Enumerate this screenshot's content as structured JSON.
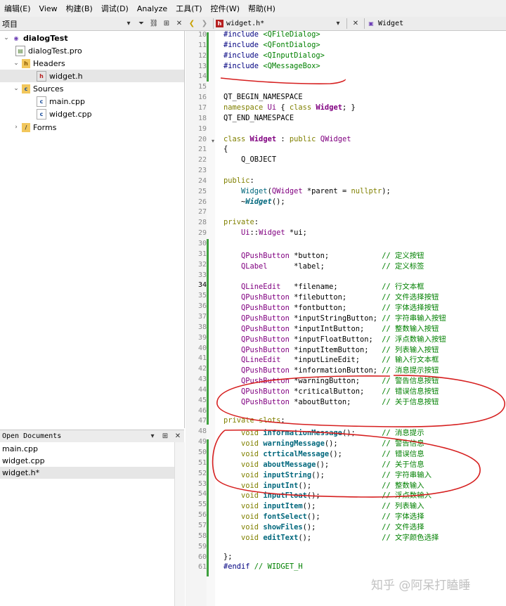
{
  "menu": [
    "编辑(E)",
    "View",
    "构建(B)",
    "调试(D)",
    "Analyze",
    "工具(T)",
    "控件(W)",
    "帮助(H)"
  ],
  "project_panel": {
    "title": "项目"
  },
  "tree": [
    {
      "label": "dialogTest",
      "bold": true
    },
    {
      "label": "dialogTest.pro"
    },
    {
      "label": "Headers"
    },
    {
      "label": "widget.h"
    },
    {
      "label": "Sources"
    },
    {
      "label": "main.cpp"
    },
    {
      "label": "widget.cpp"
    },
    {
      "label": "Forms"
    }
  ],
  "open_documents": {
    "title": "Open Documents",
    "items": [
      "main.cpp",
      "widget.cpp",
      "widget.h*"
    ]
  },
  "editor": {
    "file_tab": "widget.h*",
    "symbol": "Widget"
  },
  "code_lines": [
    {
      "n": "10",
      "c": "#include <QFileDialog>"
    },
    {
      "n": "11",
      "c": "#include <QFontDialog>"
    },
    {
      "n": "12",
      "c": "#include <QInputDialog>"
    },
    {
      "n": "13",
      "c": "#include <QMessageBox>"
    },
    {
      "n": "14",
      "c": ""
    },
    {
      "n": "15",
      "c": ""
    },
    {
      "n": "16",
      "c": "QT_BEGIN_NAMESPACE"
    },
    {
      "n": "17",
      "c": "namespace Ui { class Widget; }"
    },
    {
      "n": "18",
      "c": "QT_END_NAMESPACE"
    },
    {
      "n": "19",
      "c": ""
    },
    {
      "n": "20",
      "c": "class Widget : public QWidget"
    },
    {
      "n": "21",
      "c": "{"
    },
    {
      "n": "22",
      "c": "    Q_OBJECT"
    },
    {
      "n": "23",
      "c": ""
    },
    {
      "n": "24",
      "c": "public:"
    },
    {
      "n": "25",
      "c": "    Widget(QWidget *parent = nullptr);"
    },
    {
      "n": "26",
      "c": "    ~Widget();"
    },
    {
      "n": "27",
      "c": ""
    },
    {
      "n": "28",
      "c": "private:"
    },
    {
      "n": "29",
      "c": "    Ui::Widget *ui;"
    },
    {
      "n": "30",
      "c": ""
    },
    {
      "n": "31",
      "c": "    QPushButton *button;            // 定义按钮"
    },
    {
      "n": "32",
      "c": "    QLabel      *label;             // 定义标签"
    },
    {
      "n": "33",
      "c": ""
    },
    {
      "n": "34",
      "c": "    QLineEdit   *filename;          // 行文本框"
    },
    {
      "n": "35",
      "c": "    QPushButton *filebutton;        // 文件选择按钮"
    },
    {
      "n": "36",
      "c": "    QPushButton *fontbutton;        // 字体选择按钮"
    },
    {
      "n": "37",
      "c": "    QPushButton *inputStringButton; // 字符串输入按钮"
    },
    {
      "n": "38",
      "c": "    QPushButton *inputIntButton;    // 整数输入按钮"
    },
    {
      "n": "39",
      "c": "    QPushButton *inputFloatButton;  // 浮点数输入按钮"
    },
    {
      "n": "40",
      "c": "    QPushButton *inputItemButton;   // 列表输入按钮"
    },
    {
      "n": "41",
      "c": "    QLineEdit   *inputLineEdit;     // 输入行文本框"
    },
    {
      "n": "42",
      "c": "    QPushButton *informationButton; // 消息提示按钮"
    },
    {
      "n": "43",
      "c": "    QPushButton *warningButton;     // 警告信息按钮"
    },
    {
      "n": "44",
      "c": "    QPushButton *criticalButton;    // 错误信息按钮"
    },
    {
      "n": "45",
      "c": "    QPushButton *aboutButton;       // 关于信息按钮"
    },
    {
      "n": "46",
      "c": ""
    },
    {
      "n": "47",
      "c": "private slots:"
    },
    {
      "n": "48",
      "c": "    void informationMessage();      // 消息提示"
    },
    {
      "n": "49",
      "c": "    void warningMessage();          // 警告信息"
    },
    {
      "n": "50",
      "c": "    void ctrticalMessage();         // 错误信息"
    },
    {
      "n": "51",
      "c": "    void aboutMessage();            // 关于信息"
    },
    {
      "n": "52",
      "c": "    void inputString();             // 字符串输入"
    },
    {
      "n": "53",
      "c": "    void inputInt();                // 整数输入"
    },
    {
      "n": "54",
      "c": "    void inputFloat();              // 浮点数输入"
    },
    {
      "n": "55",
      "c": "    void inputItem();               // 列表输入"
    },
    {
      "n": "56",
      "c": "    void fontSelect();              // 字体选择"
    },
    {
      "n": "57",
      "c": "    void showFiles();               // 文件选择"
    },
    {
      "n": "58",
      "c": "    void editText();                // 文字颜色选择"
    },
    {
      "n": "59",
      "c": ""
    },
    {
      "n": "60",
      "c": "};"
    },
    {
      "n": "61",
      "c": "#endif // WIDGET_H"
    }
  ],
  "watermark": "知乎 @阿呆打瞌睡",
  "colors": {
    "annotation": "#d61f1f",
    "keyword": "#808000",
    "type": "#800080",
    "comment": "#008000",
    "function": "#00677c",
    "change_bar": "#3ea03e"
  }
}
